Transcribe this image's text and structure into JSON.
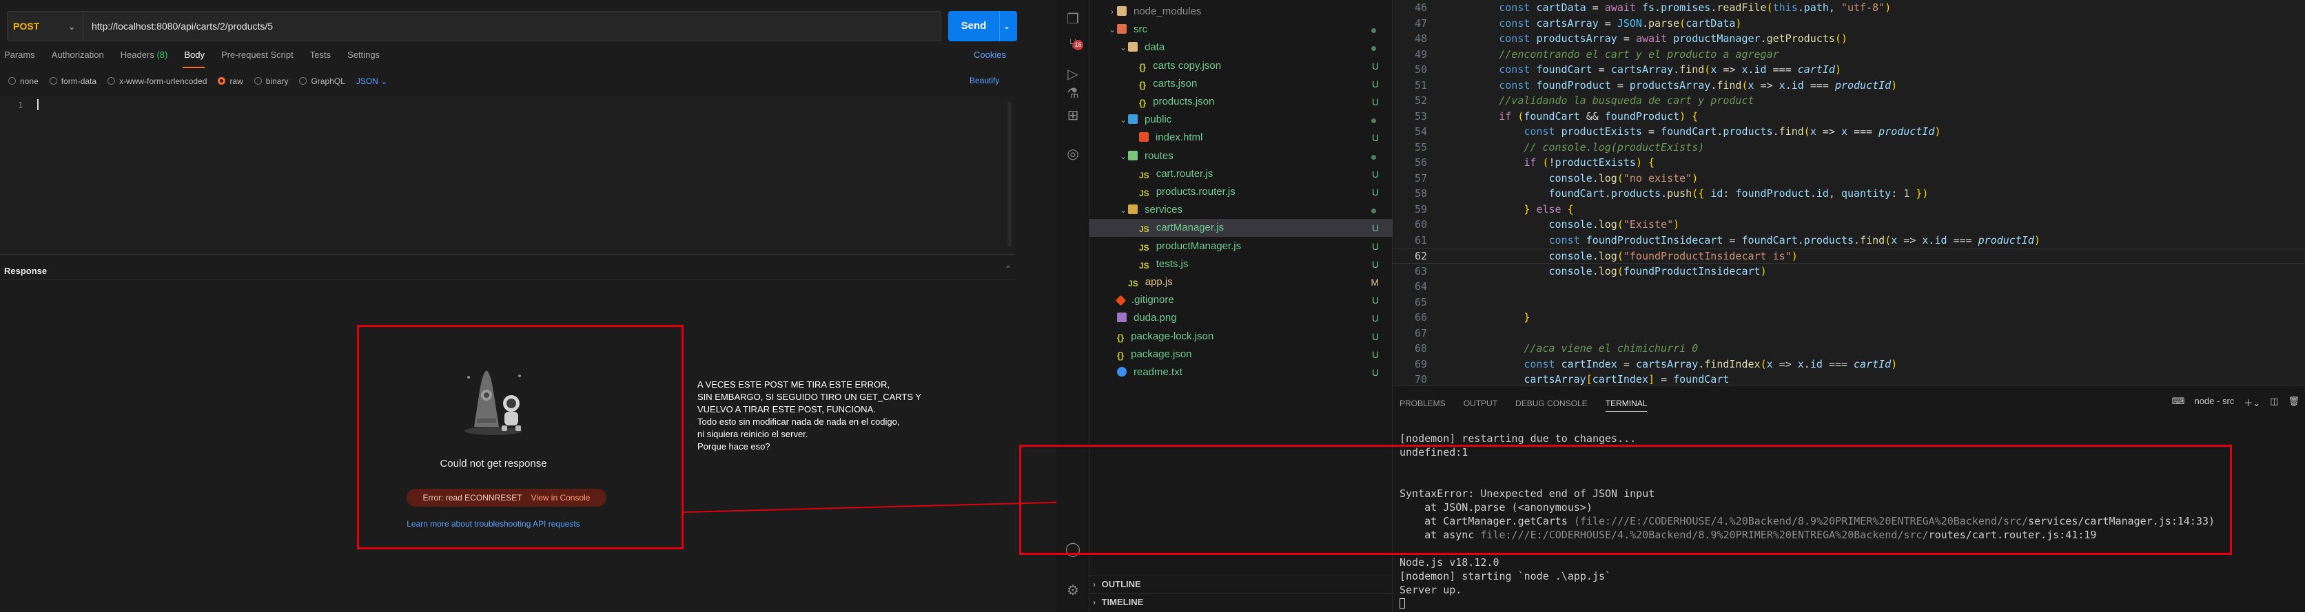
{
  "postman": {
    "method": "POST",
    "url": "http://localhost:8080/api/carts/2/products/5",
    "send_label": "Send",
    "tabs": [
      {
        "label": "Params"
      },
      {
        "label": "Authorization"
      },
      {
        "label": "Headers",
        "count": "(8)"
      },
      {
        "label": "Body"
      },
      {
        "label": "Pre-request Script"
      },
      {
        "label": "Tests"
      },
      {
        "label": "Settings"
      }
    ],
    "selected_tab": "Body",
    "cookies_label": "Cookies",
    "body_options": [
      "none",
      "form-data",
      "x-www-form-urlencoded",
      "raw",
      "binary",
      "GraphQL"
    ],
    "selected_body_option": "raw",
    "format": "JSON",
    "beautify_label": "Beautify",
    "line_number": "1",
    "response_title": "Response",
    "no_response_title": "Could not get response",
    "error_text": "Error: read ECONNRESET",
    "view_console_label": "View in Console",
    "learn_more": "Learn more about troubleshooting API requests",
    "annotation_lines": [
      "A VECES ESTE POST ME TIRA ESTE ERROR,",
      "SIN EMBARGO, SI SEGUIDO TIRO UN GET_CARTS Y",
      "VUELVO A TIRAR ESTE POST, FUNCIONA.",
      "Todo esto sin modificar nada de nada en el codigo,",
      "ni siquiera reinicio el server.",
      "Porque hace eso?"
    ],
    "colors": {
      "accent": "#ff6c37",
      "send": "#097bed",
      "method": "#ffb400",
      "highlight": "#e0000f"
    }
  },
  "vscode": {
    "activity_badge": "16",
    "explorer": [
      {
        "name": "node_modules",
        "type": "folder",
        "indent": 1,
        "chev": "›",
        "dim": true
      },
      {
        "name": "src",
        "type": "folder-src",
        "indent": 1,
        "chev": "⌄",
        "status": "dot"
      },
      {
        "name": "data",
        "type": "folder",
        "indent": 2,
        "chev": "⌄",
        "status": "dot"
      },
      {
        "name": "carts copy.json",
        "type": "json",
        "indent": 3,
        "status": "U"
      },
      {
        "name": "carts.json",
        "type": "json",
        "indent": 3,
        "status": "U"
      },
      {
        "name": "products.json",
        "type": "json",
        "indent": 3,
        "status": "U"
      },
      {
        "name": "public",
        "type": "folder-pub",
        "indent": 2,
        "chev": "⌄",
        "status": "dot"
      },
      {
        "name": "index.html",
        "type": "html",
        "indent": 3,
        "status": "U"
      },
      {
        "name": "routes",
        "type": "folder-rou",
        "indent": 2,
        "chev": "⌄",
        "status": "dot"
      },
      {
        "name": "cart.router.js",
        "type": "js",
        "indent": 3,
        "status": "U"
      },
      {
        "name": "products.router.js",
        "type": "js",
        "indent": 3,
        "status": "U"
      },
      {
        "name": "services",
        "type": "folder-ser",
        "indent": 2,
        "chev": "⌄",
        "status": "dot"
      },
      {
        "name": "cartManager.js",
        "type": "js",
        "indent": 3,
        "status": "U",
        "selected": true
      },
      {
        "name": "productManager.js",
        "type": "js",
        "indent": 3,
        "status": "U"
      },
      {
        "name": "tests.js",
        "type": "js",
        "indent": 3,
        "status": "U"
      },
      {
        "name": "app.js",
        "type": "js",
        "indent": 2,
        "status": "M"
      },
      {
        "name": ".gitignore",
        "type": "git",
        "indent": 1,
        "status": "U"
      },
      {
        "name": "duda.png",
        "type": "png",
        "indent": 1,
        "status": "U"
      },
      {
        "name": "package-lock.json",
        "type": "json",
        "indent": 1,
        "status": "U"
      },
      {
        "name": "package.json",
        "type": "json",
        "indent": 1,
        "status": "U"
      },
      {
        "name": "readme.txt",
        "type": "txt",
        "indent": 1,
        "status": "U"
      }
    ],
    "outline_label": "OUTLINE",
    "timeline_label": "TIMELINE",
    "code_lines": [
      {
        "n": "46",
        "code": "        const cartData = await fs.promises.readFile(this.path, \"utf-8\")"
      },
      {
        "n": "47",
        "code": "        const cartsArray = JSON.parse(cartData)"
      },
      {
        "n": "48",
        "code": "        const productsArray = await productManager.getProducts()"
      },
      {
        "n": "49",
        "code": "        //encontrando el cart y el producto a agregar"
      },
      {
        "n": "50",
        "code": "        const foundCart = cartsArray.find(x => x.id === cartId)"
      },
      {
        "n": "51",
        "code": "        const foundProduct = productsArray.find(x => x.id === productId)"
      },
      {
        "n": "52",
        "code": "        //validando la busqueda de cart y product"
      },
      {
        "n": "53",
        "code": "        if (foundCart && foundProduct) {"
      },
      {
        "n": "54",
        "code": "            const productExists = foundCart.products.find(x => x === productId)"
      },
      {
        "n": "55",
        "code": "            // console.log(productExists)"
      },
      {
        "n": "56",
        "code": "            if (!productExists) {"
      },
      {
        "n": "57",
        "code": "                console.log(\"no existe\")"
      },
      {
        "n": "58",
        "code": "                foundCart.products.push({ id: foundProduct.id, quantity: 1 })"
      },
      {
        "n": "59",
        "code": "            } else {"
      },
      {
        "n": "60",
        "code": "                console.log(\"Existe\")"
      },
      {
        "n": "61",
        "code": "                const foundProductInsidecart = foundCart.products.find(x => x.id === productId)"
      },
      {
        "n": "62",
        "code": "                console.log(\"foundProductInsidecart is\")"
      },
      {
        "n": "63",
        "code": "                console.log(foundProductInsidecart)"
      },
      {
        "n": "64",
        "code": ""
      },
      {
        "n": "65",
        "code": ""
      },
      {
        "n": "66",
        "code": "            }"
      },
      {
        "n": "67",
        "code": ""
      },
      {
        "n": "68",
        "code": "            //aca viene el chimichurri 0"
      },
      {
        "n": "69",
        "code": "            const cartIndex = cartsArray.findIndex(x => x.id === cartId)"
      },
      {
        "n": "70",
        "code": "            cartsArray[cartIndex] = foundCart"
      }
    ],
    "current_line": "62",
    "panel_tabs": [
      "PROBLEMS",
      "OUTPUT",
      "DEBUG CONSOLE",
      "TERMINAL"
    ],
    "selected_panel_tab": "TERMINAL",
    "terminal_name": "node - src",
    "terminal_lines": [
      "[nodemon] restarting due to changes...",
      "undefined:1",
      "",
      "",
      "SyntaxError: Unexpected end of JSON input",
      "    at JSON.parse (<anonymous>)",
      "    at CartManager.getCarts (file:///E:/CODERHOUSE/4.%20Backend/8.9%20PRIMER%20ENTREGA%20Backend/src/services/cartManager.js:14:33)",
      "    at async file:///E:/CODERHOUSE/4.%20Backend/8.9%20PRIMER%20ENTREGA%20Backend/src/routes/cart.router.js:41:19",
      "",
      "Node.js v18.12.0",
      "[nodemon] starting `node .\\app.js`",
      "Server up."
    ]
  }
}
